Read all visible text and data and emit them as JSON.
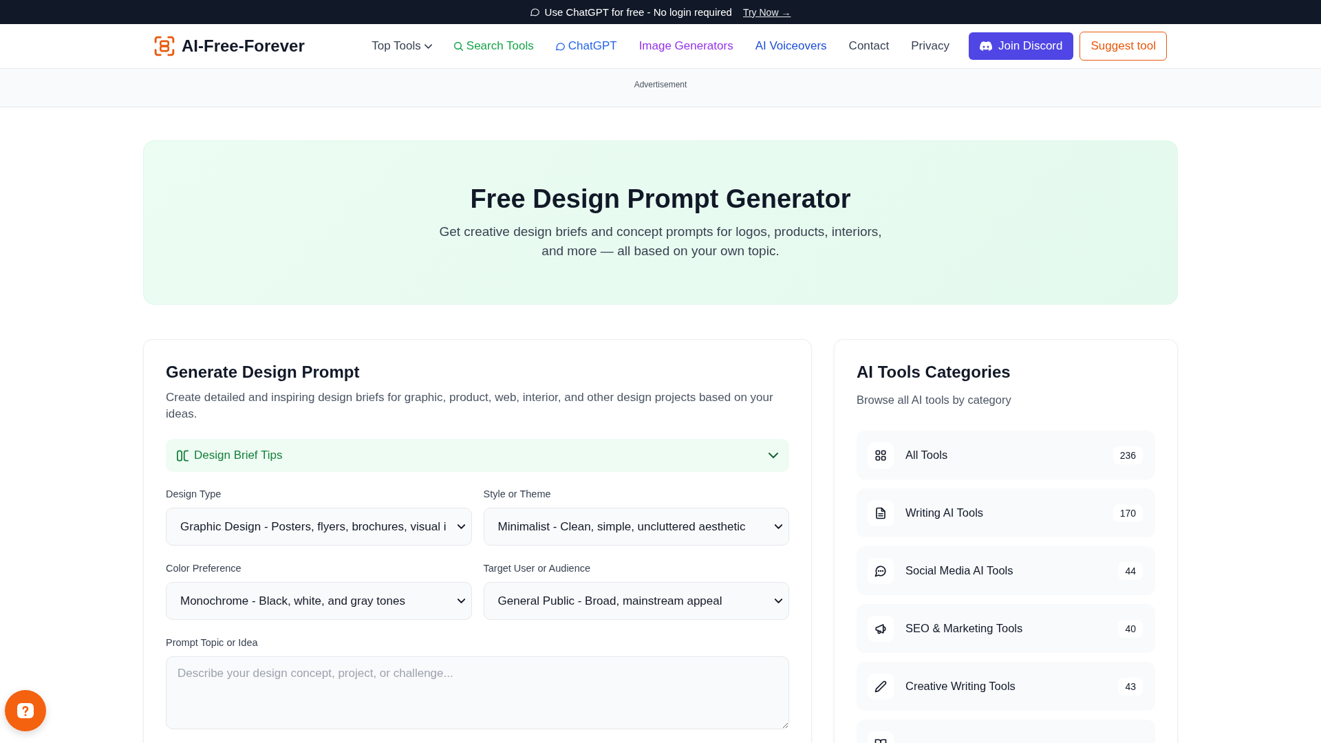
{
  "announcement": {
    "text": "Use ChatGPT for free - No login required",
    "link": "Try Now →"
  },
  "header": {
    "logo": "AI-Free-Forever",
    "nav": [
      {
        "label": "Top Tools",
        "kind": "dropdown",
        "color": "#374151"
      },
      {
        "label": "Search Tools",
        "kind": "search",
        "color": "#16a34a"
      },
      {
        "label": "ChatGPT",
        "kind": "chat",
        "color": "#2563eb"
      },
      {
        "label": "Image Generators",
        "kind": "plain",
        "color": "#9333ea"
      },
      {
        "label": "AI Voiceovers",
        "kind": "plain",
        "color": "#1d4ed8"
      },
      {
        "label": "Contact",
        "kind": "plain",
        "color": "#374151"
      },
      {
        "label": "Privacy",
        "kind": "plain",
        "color": "#374151"
      }
    ],
    "buttons": [
      {
        "label": "Join Discord",
        "kind": "primary"
      },
      {
        "label": "Suggest tool",
        "kind": "outline"
      }
    ]
  },
  "ad_bar": {
    "label": "Advertisement"
  },
  "hero": {
    "title": "Free Design Prompt Generator",
    "subtitle": "Get creative design briefs and concept prompts for logos, products, interiors, and more — all based on your own topic."
  },
  "generator": {
    "title": "Generate Design Prompt",
    "description": "Create detailed and inspiring design briefs for graphic, product, web, interior, and other design projects based on your ideas.",
    "tips": {
      "label": "Design Brief Tips",
      "expanded": false
    },
    "fields": [
      {
        "label": "Design Type",
        "value": "Graphic Design - Posters, flyers, brochures, visual i"
      },
      {
        "label": "Style or Theme",
        "value": "Minimalist - Clean, simple, uncluttered aesthetic"
      },
      {
        "label": "Color Preference",
        "value": "Monochrome - Black, white, and gray tones"
      },
      {
        "label": "Target User or Audience",
        "value": "General Public - Broad, mainstream appeal"
      }
    ],
    "topic": {
      "label": "Prompt Topic or Idea",
      "placeholder": "Describe your design concept, project, or challenge..."
    }
  },
  "categories": {
    "title": "AI Tools Categories",
    "subtitle": "Browse all AI tools by category",
    "items": [
      {
        "label": "All Tools",
        "count": "236",
        "kind": "all"
      },
      {
        "label": "Writing AI Tools",
        "count": "170",
        "kind": "writing"
      },
      {
        "label": "Social Media AI Tools",
        "count": "44",
        "kind": "social"
      },
      {
        "label": "SEO & Marketing Tools",
        "count": "40",
        "kind": "marketing"
      },
      {
        "label": "Creative Writing Tools",
        "count": "43",
        "kind": "creative"
      },
      {
        "kind": "academic"
      }
    ]
  }
}
